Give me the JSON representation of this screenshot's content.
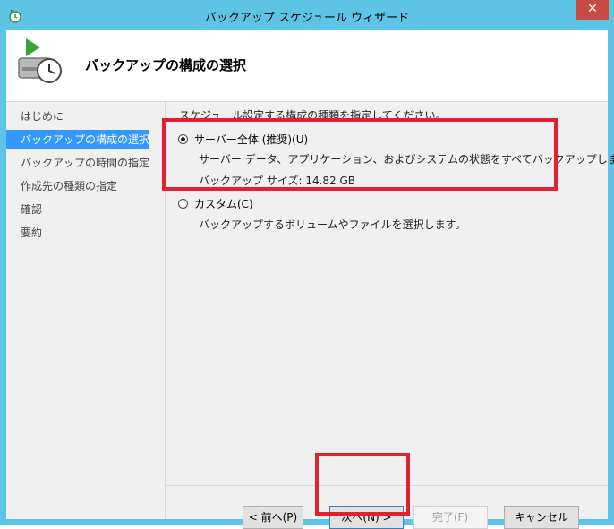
{
  "window": {
    "title": "バックアップ スケジュール ウィザード",
    "close_label": "✕"
  },
  "header": {
    "title": "バックアップの構成の選択"
  },
  "sidebar": {
    "steps": [
      {
        "label": "はじめに",
        "active": false
      },
      {
        "label": "バックアップの構成の選択",
        "active": true
      },
      {
        "label": "バックアップの時間の指定",
        "active": false
      },
      {
        "label": "作成先の種類の指定",
        "active": false
      },
      {
        "label": "確認",
        "active": false
      },
      {
        "label": "要約",
        "active": false
      }
    ]
  },
  "main": {
    "instruction": "スケジュール設定する構成の種類を指定してください。",
    "options": [
      {
        "label": "サーバー全体 (推奨)(U)",
        "checked": true,
        "description": "サーバー データ、アプリケーション、およびシステムの状態をすべてバックアップします。",
        "size_text": "バックアップ サイズ: 14.82 GB"
      },
      {
        "label": "カスタム(C)",
        "checked": false,
        "description": "バックアップするボリュームやファイルを選択します。"
      }
    ]
  },
  "buttons": {
    "back": "< 前へ(P)",
    "next": "次へ(N) >",
    "finish": "完了(F)",
    "cancel": "キャンセル"
  },
  "colors": {
    "titlebar": "#5ec4e6",
    "selection": "#3399ff",
    "highlight": "#e3202e",
    "close": "#c74b43"
  }
}
